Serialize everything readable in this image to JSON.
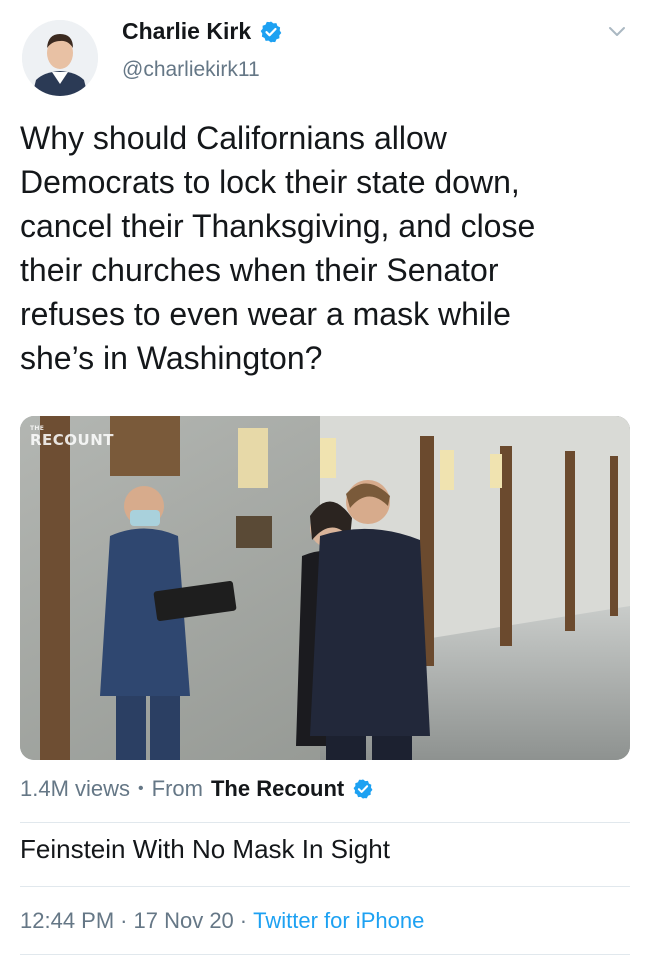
{
  "author": {
    "name": "Charlie Kirk",
    "handle": "@charliekirk11",
    "verified": true
  },
  "tweet": {
    "text": "Why should Californians allow\nDemocrats to lock their state down,\ncancel their Thanksgiving, and close\ntheir churches when their Senator\nrefuses to even wear a mask while\nshe’s in Washington?"
  },
  "video": {
    "watermark_small": "THE",
    "watermark": "RECOUNT",
    "views": "1.4M views",
    "from_label": "From",
    "source": "The Recount",
    "source_verified": true,
    "title": "Feinstein With No Mask In Sight"
  },
  "meta": {
    "time": "12:44 PM",
    "date": "17 Nov 20",
    "client": "Twitter for iPhone"
  },
  "colors": {
    "verified_blue": "#1da1f2",
    "secondary_text": "#657786",
    "link": "#1da1f2"
  }
}
